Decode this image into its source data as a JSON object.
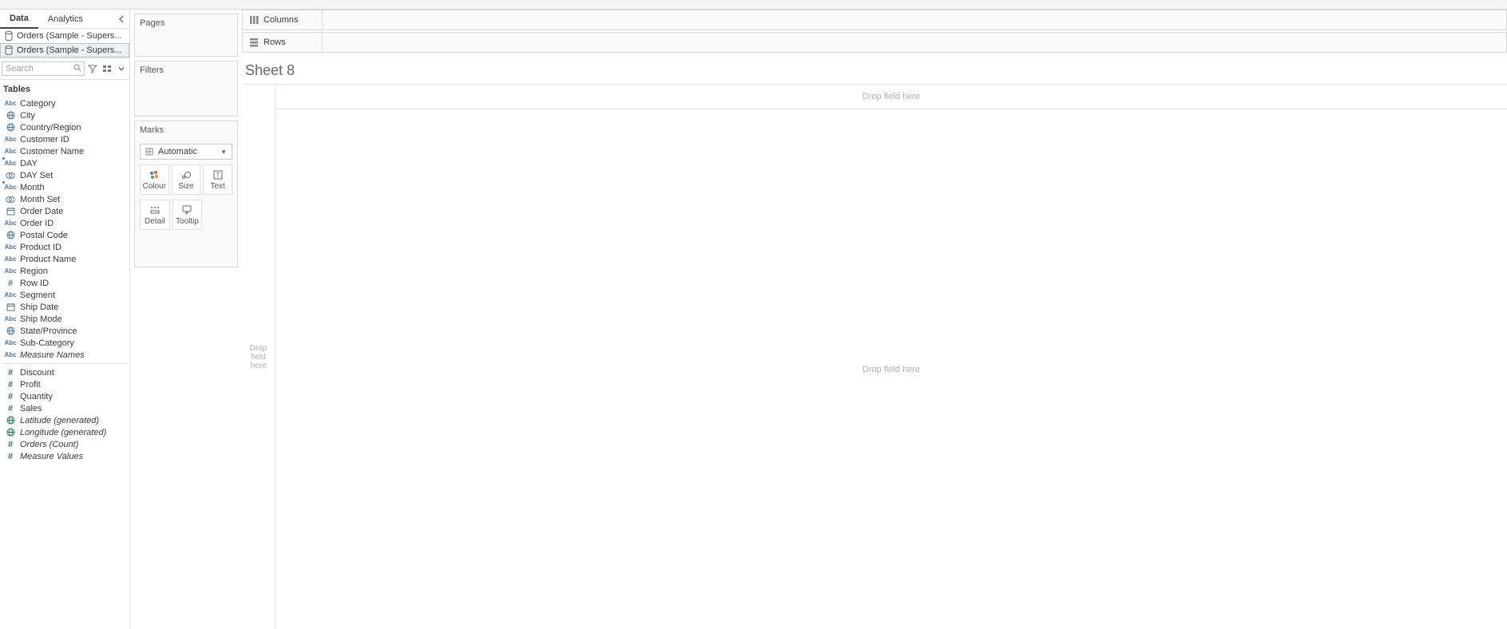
{
  "tabs": {
    "data": "Data",
    "analytics": "Analytics"
  },
  "datasources": [
    {
      "name": "Orders (Sample - Supers...",
      "selected": false
    },
    {
      "name": "Orders (Sample - Supers...",
      "selected": true
    }
  ],
  "search": {
    "placeholder": "Search"
  },
  "tables_label": "Tables",
  "fields": [
    {
      "label": "Category",
      "icon": "abc",
      "role": "dim",
      "italic": false
    },
    {
      "label": "City",
      "icon": "globe",
      "role": "dim",
      "italic": false
    },
    {
      "label": "Country/Region",
      "icon": "globe",
      "role": "dim",
      "italic": false
    },
    {
      "label": "Customer ID",
      "icon": "abc",
      "role": "dim",
      "italic": false
    },
    {
      "label": "Customer Name",
      "icon": "abc",
      "role": "dim",
      "italic": false
    },
    {
      "label": "DAY",
      "icon": "abc",
      "role": "dim",
      "italic": false,
      "calc": true
    },
    {
      "label": "DAY Set",
      "icon": "set",
      "role": "dim",
      "italic": false
    },
    {
      "label": "Month",
      "icon": "abc",
      "role": "dim",
      "italic": false,
      "calc": true
    },
    {
      "label": "Month Set",
      "icon": "set",
      "role": "dim",
      "italic": false
    },
    {
      "label": "Order Date",
      "icon": "date",
      "role": "dim",
      "italic": false
    },
    {
      "label": "Order ID",
      "icon": "abc",
      "role": "dim",
      "italic": false
    },
    {
      "label": "Postal Code",
      "icon": "globe",
      "role": "dim",
      "italic": false
    },
    {
      "label": "Product ID",
      "icon": "abc",
      "role": "dim",
      "italic": false
    },
    {
      "label": "Product Name",
      "icon": "abc",
      "role": "dim",
      "italic": false
    },
    {
      "label": "Region",
      "icon": "abc",
      "role": "dim",
      "italic": false
    },
    {
      "label": "Row ID",
      "icon": "hash",
      "role": "dim",
      "italic": false
    },
    {
      "label": "Segment",
      "icon": "abc",
      "role": "dim",
      "italic": false
    },
    {
      "label": "Ship Date",
      "icon": "date",
      "role": "dim",
      "italic": false
    },
    {
      "label": "Ship Mode",
      "icon": "abc",
      "role": "dim",
      "italic": false
    },
    {
      "label": "State/Province",
      "icon": "globe",
      "role": "dim",
      "italic": false
    },
    {
      "label": "Sub-Category",
      "icon": "abc",
      "role": "dim",
      "italic": false
    },
    {
      "label": "Measure Names",
      "icon": "abc",
      "role": "dim",
      "italic": true
    },
    {
      "separator": true
    },
    {
      "label": "Discount",
      "icon": "hash",
      "role": "meas",
      "italic": false
    },
    {
      "label": "Profit",
      "icon": "hash",
      "role": "meas",
      "italic": false
    },
    {
      "label": "Quantity",
      "icon": "hash",
      "role": "meas",
      "italic": false
    },
    {
      "label": "Sales",
      "icon": "hash",
      "role": "meas",
      "italic": false
    },
    {
      "label": "Latitude (generated)",
      "icon": "globe",
      "role": "meas",
      "italic": true
    },
    {
      "label": "Longitude (generated)",
      "icon": "globe",
      "role": "meas",
      "italic": true
    },
    {
      "label": "Orders (Count)",
      "icon": "hash",
      "role": "meas",
      "italic": true
    },
    {
      "label": "Measure Values",
      "icon": "hash",
      "role": "meas",
      "italic": true
    }
  ],
  "shelves": {
    "pages": "Pages",
    "filters": "Filters",
    "marks": "Marks",
    "columns": "Columns",
    "rows": "Rows"
  },
  "marks": {
    "selected": "Automatic",
    "cells1": [
      {
        "key": "colour",
        "label": "Colour"
      },
      {
        "key": "size",
        "label": "Size"
      },
      {
        "key": "text",
        "label": "Text"
      }
    ],
    "cells2": [
      {
        "key": "detail",
        "label": "Detail"
      },
      {
        "key": "tooltip",
        "label": "Tooltip"
      }
    ]
  },
  "view": {
    "title": "Sheet 8",
    "drop_col": "Drop field here",
    "drop_row": "Drop\nfield\nhere",
    "drop_main": "Drop field here"
  }
}
